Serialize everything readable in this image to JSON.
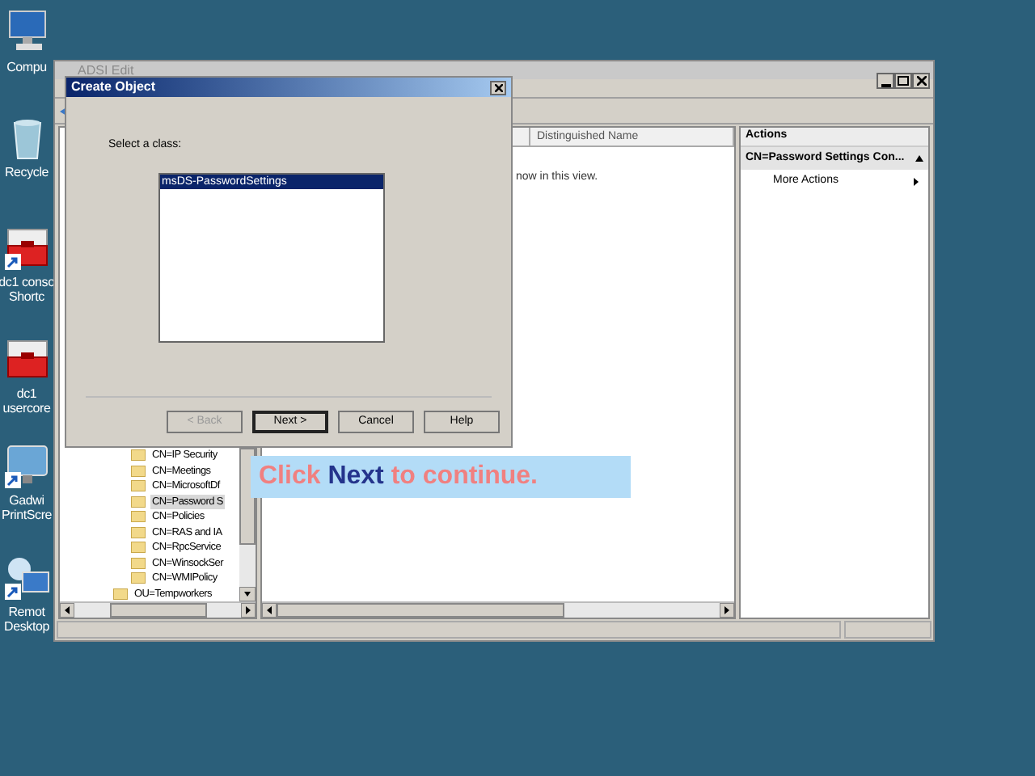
{
  "desktop_icons": [
    {
      "kind": "computer",
      "label": [
        "Compu"
      ],
      "shortcut": false
    },
    {
      "kind": "recycle",
      "label": [
        "Recycle"
      ],
      "shortcut": false
    },
    {
      "kind": "toolbox",
      "label": [
        "dc1 conso",
        "Shortc"
      ],
      "shortcut": true
    },
    {
      "kind": "toolbox",
      "label": [
        "dc1",
        "usercore"
      ],
      "shortcut": false
    },
    {
      "kind": "monitor",
      "label": [
        "Gadwi",
        "PrintScre"
      ],
      "shortcut": true
    },
    {
      "kind": "remote",
      "label": [
        "Remot",
        "Desktop"
      ],
      "shortcut": true
    }
  ],
  "main_window": {
    "title": "ADSI Edit",
    "tree": [
      {
        "children": [
          {
            "label": "CN=IP Security",
            "selected": false
          },
          {
            "label": "CN=Meetings",
            "selected": false
          },
          {
            "label": "CN=MicrosoftDf",
            "selected": false
          },
          {
            "label": "CN=Password S",
            "selected": true
          },
          {
            "label": "CN=Policies",
            "selected": false
          },
          {
            "label": "CN=RAS and IA",
            "selected": false
          },
          {
            "label": "CN=RpcService",
            "selected": false
          },
          {
            "label": "CN=WinsockSer",
            "selected": false
          },
          {
            "label": "CN=WMIPolicy",
            "selected": false
          }
        ]
      },
      {
        "label": "OU=Tempworkers",
        "selected": false
      }
    ],
    "list": {
      "columns": [
        "Distinguished Name"
      ],
      "empty_text": "now in this view."
    },
    "actions": {
      "title": "Actions",
      "section": "CN=Password Settings Con...",
      "items": [
        "More Actions"
      ]
    }
  },
  "dialog": {
    "title": "Create Object",
    "prompt": "Select a class:",
    "classes": [
      {
        "label": "msDS-PasswordSettings",
        "selected": true
      }
    ],
    "buttons": [
      {
        "label": "< Back",
        "disabled": true,
        "default": false
      },
      {
        "label": "Next >",
        "disabled": false,
        "default": true
      },
      {
        "label": "Cancel",
        "disabled": false,
        "default": false
      },
      {
        "label": "Help",
        "disabled": false,
        "default": false
      }
    ]
  },
  "callout": {
    "before": "Click",
    "emphasis": "Next",
    "after": "to continue."
  }
}
